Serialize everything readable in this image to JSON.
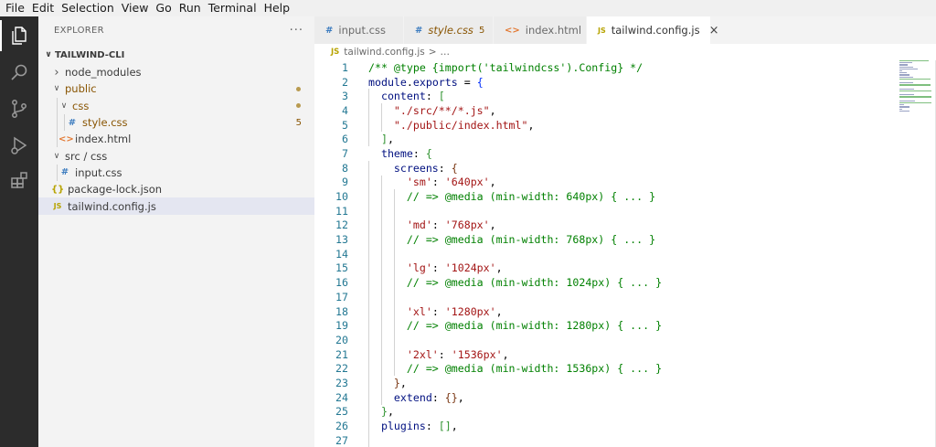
{
  "menu": [
    "File",
    "Edit",
    "Selection",
    "View",
    "Go",
    "Run",
    "Terminal",
    "Help"
  ],
  "activity_bar": {
    "icons": [
      "explorer-icon",
      "search-icon",
      "source-control-icon",
      "run-debug-icon",
      "extensions-icon"
    ]
  },
  "sidebar": {
    "title": "EXPLORER",
    "more": "···",
    "section": "TAILWIND-CLI",
    "tree": [
      {
        "name": "node_modules",
        "type": "folder",
        "expanded": false,
        "depth": 0
      },
      {
        "name": "public",
        "type": "folder",
        "expanded": true,
        "depth": 0,
        "modified": true
      },
      {
        "name": "css",
        "type": "folder",
        "expanded": true,
        "depth": 1,
        "modified": true
      },
      {
        "name": "style.css",
        "type": "css",
        "depth": 2,
        "modified": true,
        "badge": "5"
      },
      {
        "name": "index.html",
        "type": "html",
        "depth": 1
      },
      {
        "name": "src / css",
        "type": "folder",
        "expanded": true,
        "depth": 0
      },
      {
        "name": "input.css",
        "type": "css",
        "depth": 1
      },
      {
        "name": "package-lock.json",
        "type": "json",
        "depth": 0
      },
      {
        "name": "tailwind.config.js",
        "type": "js",
        "depth": 0,
        "selected": true
      }
    ]
  },
  "tabs": [
    {
      "label": "input.css",
      "icon": "#",
      "type": "css"
    },
    {
      "label": "style.css",
      "icon": "#",
      "type": "css",
      "modified": true,
      "badge": "5"
    },
    {
      "label": "index.html",
      "icon": "<>",
      "type": "html"
    },
    {
      "label": "tailwind.config.js",
      "icon": "JS",
      "type": "js",
      "active": true,
      "close": "×"
    }
  ],
  "breadcrumbs": {
    "icon": "JS",
    "file": "tailwind.config.js",
    "sep": ">",
    "rest": "…"
  },
  "code_lines": [
    [
      [
        "/** @type {import('tailwindcss').Config} */",
        "comment"
      ]
    ],
    [
      [
        "module",
        "key"
      ],
      [
        ".",
        "punct"
      ],
      [
        "exports",
        "key"
      ],
      [
        " = ",
        "punct"
      ],
      [
        "{",
        "brace1"
      ]
    ],
    [
      [
        "  content",
        "key"
      ],
      [
        ": ",
        "punct"
      ],
      [
        "[",
        "brace2"
      ]
    ],
    [
      [
        "    \"./src/**/*.js\"",
        "str"
      ],
      [
        ",",
        "punct"
      ]
    ],
    [
      [
        "    \"./public/index.html\"",
        "str"
      ],
      [
        ",",
        "punct"
      ]
    ],
    [
      [
        "  ",
        "punct"
      ],
      [
        "]",
        "brace2"
      ],
      [
        ",",
        "punct"
      ]
    ],
    [
      [
        "  theme",
        "key"
      ],
      [
        ": ",
        "punct"
      ],
      [
        "{",
        "brace2"
      ]
    ],
    [
      [
        "    screens",
        "key"
      ],
      [
        ": ",
        "punct"
      ],
      [
        "{",
        "brace3"
      ]
    ],
    [
      [
        "      'sm'",
        "str"
      ],
      [
        ": ",
        "punct"
      ],
      [
        "'640px'",
        "str"
      ],
      [
        ",",
        "punct"
      ]
    ],
    [
      [
        "      // => @media (min-width: 640px) { ... }",
        "comment"
      ]
    ],
    [
      [
        "",
        "punct"
      ]
    ],
    [
      [
        "      'md'",
        "str"
      ],
      [
        ": ",
        "punct"
      ],
      [
        "'768px'",
        "str"
      ],
      [
        ",",
        "punct"
      ]
    ],
    [
      [
        "      // => @media (min-width: 768px) { ... }",
        "comment"
      ]
    ],
    [
      [
        "",
        "punct"
      ]
    ],
    [
      [
        "      'lg'",
        "str"
      ],
      [
        ": ",
        "punct"
      ],
      [
        "'1024px'",
        "str"
      ],
      [
        ",",
        "punct"
      ]
    ],
    [
      [
        "      // => @media (min-width: 1024px) { ... }",
        "comment"
      ]
    ],
    [
      [
        "",
        "punct"
      ]
    ],
    [
      [
        "      'xl'",
        "str"
      ],
      [
        ": ",
        "punct"
      ],
      [
        "'1280px'",
        "str"
      ],
      [
        ",",
        "punct"
      ]
    ],
    [
      [
        "      // => @media (min-width: 1280px) { ... }",
        "comment"
      ]
    ],
    [
      [
        "",
        "punct"
      ]
    ],
    [
      [
        "      '2xl'",
        "str"
      ],
      [
        ": ",
        "punct"
      ],
      [
        "'1536px'",
        "str"
      ],
      [
        ",",
        "punct"
      ]
    ],
    [
      [
        "      // => @media (min-width: 1536px) { ... }",
        "comment"
      ]
    ],
    [
      [
        "    ",
        "punct"
      ],
      [
        "}",
        "brace3"
      ],
      [
        ",",
        "punct"
      ]
    ],
    [
      [
        "    extend",
        "key"
      ],
      [
        ": ",
        "punct"
      ],
      [
        "{}",
        "brace3"
      ],
      [
        ",",
        "punct"
      ]
    ],
    [
      [
        "  ",
        "punct"
      ],
      [
        "}",
        "brace2"
      ],
      [
        ",",
        "punct"
      ]
    ],
    [
      [
        "  plugins",
        "key"
      ],
      [
        ": ",
        "punct"
      ],
      [
        "[]",
        "brace2"
      ],
      [
        ",",
        "punct"
      ]
    ],
    [
      [
        "",
        "punct"
      ]
    ]
  ],
  "colors": {
    "activity_bar": "#2c2c2c",
    "sidebar": "#f3f3f3",
    "selected_row": "#e4e6f1",
    "modified": "#895503",
    "line_number": "#237893",
    "comment": "#008000",
    "string": "#a31515",
    "property": "#001080"
  }
}
